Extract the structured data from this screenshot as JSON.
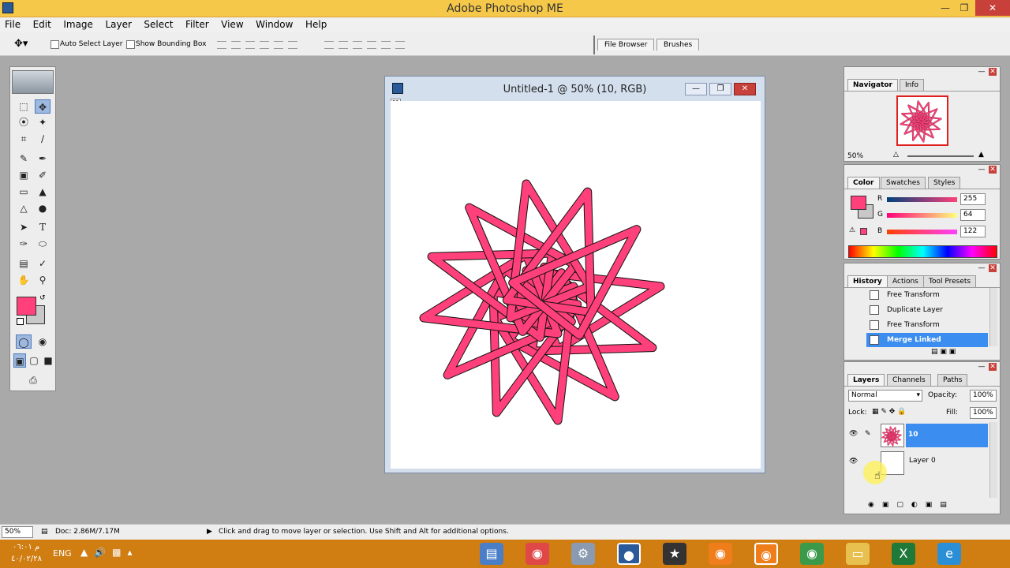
{
  "window": {
    "title": "Adobe Photoshop ME"
  },
  "menu": [
    "File",
    "Edit",
    "Image",
    "Layer",
    "Select",
    "Filter",
    "View",
    "Window",
    "Help"
  ],
  "options": {
    "auto_select": "Auto Select Layer",
    "show_bounding": "Show Bounding Box",
    "tab1": "File Browser",
    "tab2": "Brushes"
  },
  "document": {
    "title": "Untitled-1 @ 50% (10, RGB)",
    "corner": "01"
  },
  "navigator": {
    "tabs": [
      "Navigator",
      "Info"
    ],
    "zoom": "50%"
  },
  "color": {
    "tabs": [
      "Color",
      "Swatches",
      "Styles"
    ],
    "r_label": "R",
    "g_label": "G",
    "b_label": "B",
    "r": "255",
    "g": "64",
    "b": "122",
    "fg": "#ff407a"
  },
  "history": {
    "tabs": [
      "History",
      "Actions",
      "Tool Presets"
    ],
    "items": [
      "Free Transform",
      "Duplicate Layer",
      "Free Transform",
      "Merge Linked"
    ]
  },
  "layers": {
    "tabs": [
      "Layers",
      "Channels",
      "Paths"
    ],
    "blend": "Normal",
    "opacity_label": "Opacity:",
    "opacity": "100%",
    "lock_label": "Lock:",
    "fill_label": "Fill:",
    "fill": "100%",
    "items": [
      "10",
      "Layer 0"
    ]
  },
  "status": {
    "zoom": "50%",
    "doc": "Doc: 2.86M/7.17M",
    "hint": "Click and drag to move layer or selection.  Use Shift and Alt for additional options."
  },
  "taskbar": {
    "lang": "ENG",
    "time": "م ٠٦:٠١",
    "date": "٤٠/٠٢/٢٨"
  }
}
